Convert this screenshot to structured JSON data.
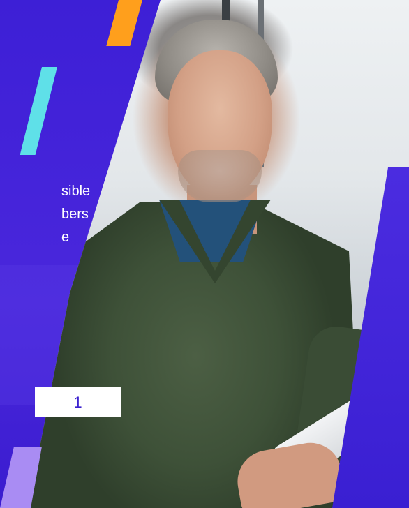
{
  "text_lines": [
    "sible",
    "bers",
    "e"
  ],
  "page_indicator": "1",
  "colors": {
    "primary_purple": "#3b1ad0",
    "accent_orange": "#ff9f1c",
    "accent_cyan": "#5fe0e8",
    "accent_lilac": "#a98cf3",
    "page_box_text": "#3b21cf"
  }
}
